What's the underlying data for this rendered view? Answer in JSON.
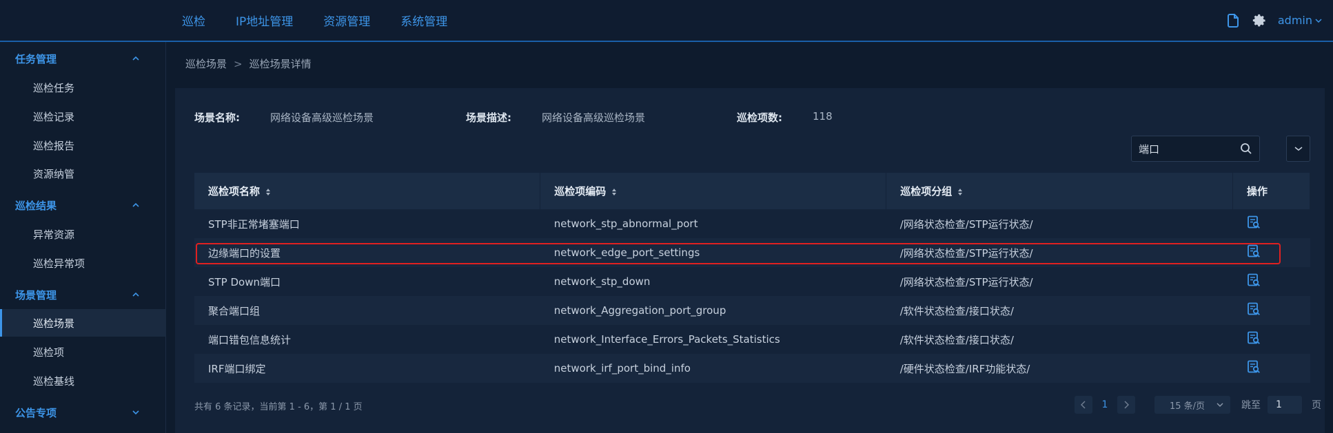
{
  "topnav": {
    "items": [
      {
        "label": "巡检"
      },
      {
        "label": "IP地址管理"
      },
      {
        "label": "资源管理"
      },
      {
        "label": "系统管理"
      }
    ],
    "user": "admin"
  },
  "sidebar": {
    "groups": [
      {
        "label": "任务管理",
        "items": [
          {
            "label": "巡检任务"
          },
          {
            "label": "巡检记录"
          },
          {
            "label": "巡检报告"
          },
          {
            "label": "资源纳管"
          }
        ]
      },
      {
        "label": "巡检结果",
        "items": [
          {
            "label": "异常资源"
          },
          {
            "label": "巡检异常项"
          }
        ]
      },
      {
        "label": "场景管理",
        "items": [
          {
            "label": "巡检场景"
          },
          {
            "label": "巡检项"
          },
          {
            "label": "巡检基线"
          }
        ]
      },
      {
        "label": "公告专项",
        "items": []
      }
    ],
    "active_item": "巡检场景"
  },
  "breadcrumb": {
    "root": "巡检场景",
    "separator": ">",
    "current": "巡检场景详情"
  },
  "info": {
    "name_label": "场景名称:",
    "name_value": "网络设备高级巡检场景",
    "desc_label": "场景描述:",
    "desc_value": "网络设备高级巡检场景",
    "count_label": "巡检项数:",
    "count_value": "118"
  },
  "search": {
    "value": "端口"
  },
  "table": {
    "headers": [
      "巡检项名称",
      "巡检项编码",
      "巡检项分组",
      "操作"
    ],
    "rows": [
      {
        "name": "STP非正常堵塞端口",
        "code": "network_stp_abnormal_port",
        "group": "/网络状态检查/STP运行状态/"
      },
      {
        "name": "边缘端口的设置",
        "code": "network_edge_port_settings",
        "group": "/网络状态检查/STP运行状态/"
      },
      {
        "name": "STP Down端口",
        "code": "network_stp_down",
        "group": "/网络状态检查/STP运行状态/"
      },
      {
        "name": "聚合端口组",
        "code": "network_Aggregation_port_group",
        "group": "/软件状态检查/接口状态/"
      },
      {
        "name": "端口错包信息统计",
        "code": "network_Interface_Errors_Packets_Statistics",
        "group": "/软件状态检查/接口状态/"
      },
      {
        "name": "IRF端口绑定",
        "code": "network_irf_port_bind_info",
        "group": "/硬件状态检查/IRF功能状态/"
      }
    ]
  },
  "footer": {
    "summary": "共有 6 条记录，当前第 1 - 6，第 1 / 1 页",
    "page": "1",
    "page_size": "15 条/页",
    "goto_label": "跳至",
    "goto_value": "1",
    "page_suffix": "页"
  },
  "colors": {
    "accent": "#3d95e8",
    "highlight": "#e02020"
  }
}
